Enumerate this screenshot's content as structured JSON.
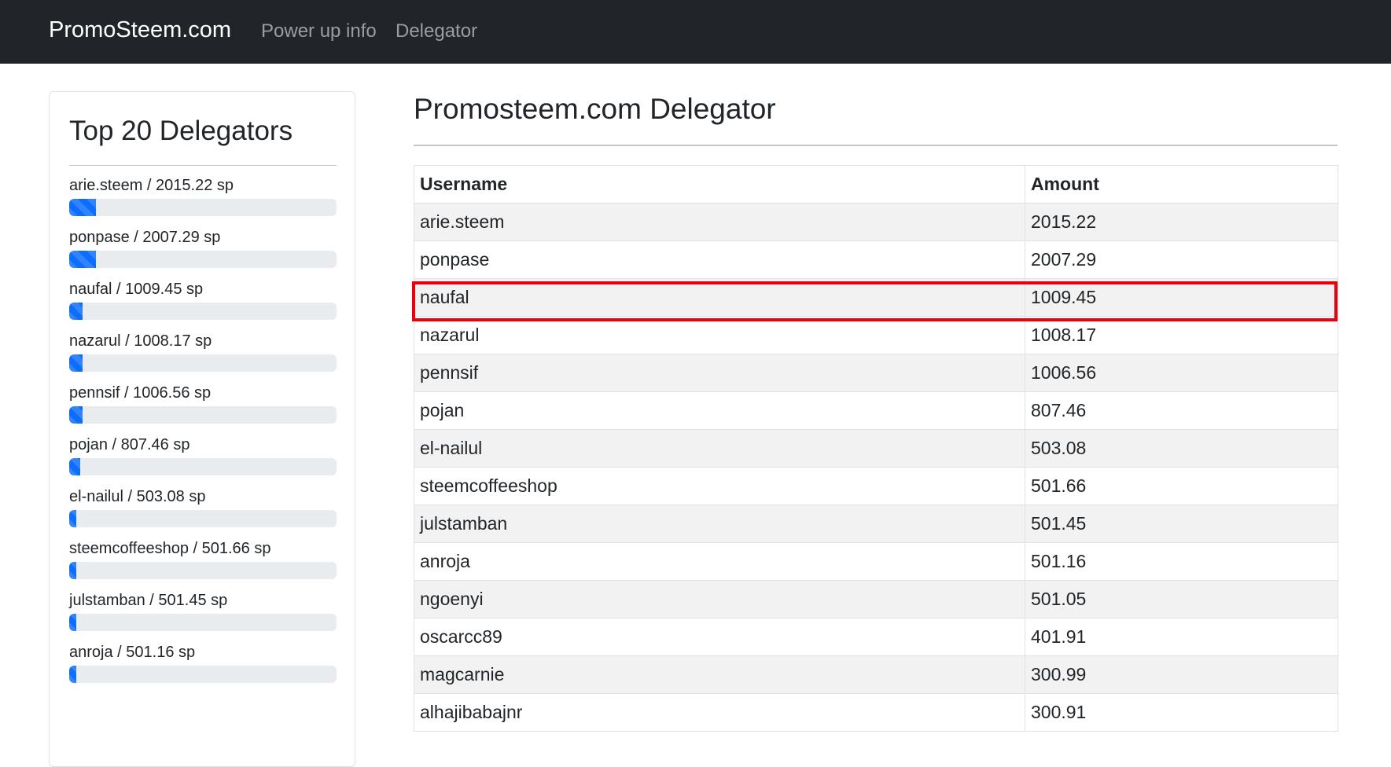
{
  "navbar": {
    "brand": "PromoSteem.com",
    "links": [
      "Power up info",
      "Delegator"
    ]
  },
  "sidebar": {
    "title": "Top 20 Delegators",
    "items": [
      {
        "label": "arie.steem / 2015.22 sp",
        "progress": 0.1
      },
      {
        "label": "ponpase / 2007.29 sp",
        "progress": 0.1
      },
      {
        "label": "naufal / 1009.45 sp",
        "progress": 0.05
      },
      {
        "label": "nazarul / 1008.17 sp",
        "progress": 0.05
      },
      {
        "label": "pennsif / 1006.56 sp",
        "progress": 0.05
      },
      {
        "label": "pojan / 807.46 sp",
        "progress": 0.04
      },
      {
        "label": "el-nailul / 503.08 sp",
        "progress": 0.025
      },
      {
        "label": "steemcoffeeshop / 501.66 sp",
        "progress": 0.025
      },
      {
        "label": "julstamban / 501.45 sp",
        "progress": 0.025
      },
      {
        "label": "anroja / 501.16 sp",
        "progress": 0.025
      }
    ]
  },
  "main": {
    "title": "Promosteem.com Delegator",
    "table": {
      "headers": [
        "Username",
        "Amount"
      ],
      "rows": [
        [
          "arie.steem",
          "2015.22"
        ],
        [
          "ponpase",
          "2007.29"
        ],
        [
          "naufal",
          "1009.45"
        ],
        [
          "nazarul",
          "1008.17"
        ],
        [
          "pennsif",
          "1006.56"
        ],
        [
          "pojan",
          "807.46"
        ],
        [
          "el-nailul",
          "503.08"
        ],
        [
          "steemcoffeeshop",
          "501.66"
        ],
        [
          "julstamban",
          "501.45"
        ],
        [
          "anroja",
          "501.16"
        ],
        [
          "ngoenyi",
          "501.05"
        ],
        [
          "oscarcc89",
          "401.91"
        ],
        [
          "magcarnie",
          "300.99"
        ],
        [
          "alhajibabajnr",
          "300.91"
        ]
      ]
    },
    "highlighted_row": 2
  },
  "colors": {
    "navbar_bg": "#212529",
    "progress_fill": "#0d6efd",
    "highlight_border": "#e8000b"
  }
}
